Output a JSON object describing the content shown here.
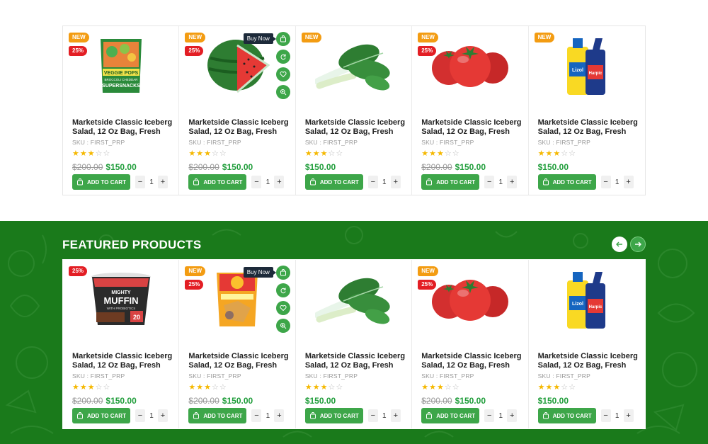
{
  "colors": {
    "green": "#3da649",
    "section_bg": "#1a7a1b",
    "badge_new": "#f39c12",
    "badge_off": "#e31e24"
  },
  "tooltip": "Buy Now",
  "featured": {
    "title": "FEATURED PRODUCTS"
  },
  "row1": [
    {
      "new": "NEW",
      "off": "25%",
      "title": "Marketside Classic Iceberg Salad, 12 Oz Bag, Fresh",
      "sku": "SKU : FIRST_PRP",
      "old": "$200.00",
      "price": "$150.00",
      "cart": "ADD TO CART",
      "qty": "1",
      "rating": 3,
      "image": "veggie-pops-bag-icon"
    },
    {
      "new": "NEW",
      "off": "25%",
      "title": "Marketside Classic Iceberg Salad, 12 Oz Bag, Fresh",
      "sku": "SKU : FIRST_PRP",
      "old": "$200.00",
      "price": "$150.00",
      "cart": "ADD TO CART",
      "qty": "1",
      "rating": 3,
      "image": "watermelon-icon"
    },
    {
      "new": "NEW",
      "title": "Marketside Classic Iceberg Salad, 12 Oz Bag, Fresh",
      "sku": "SKU : FIRST_PRP",
      "price": "$150.00",
      "cart": "ADD TO CART",
      "qty": "1",
      "rating": 3,
      "image": "bok-choy-icon"
    },
    {
      "new": "NEW",
      "off": "25%",
      "title": "Marketside Classic Iceberg Salad, 12 Oz Bag, Fresh",
      "sku": "SKU : FIRST_PRP",
      "old": "$200.00",
      "price": "$150.00",
      "cart": "ADD TO CART",
      "qty": "1",
      "rating": 3,
      "image": "tomatoes-icon"
    },
    {
      "new": "NEW",
      "title": "Marketside Classic Iceberg Salad, 12 Oz Bag, Fresh",
      "sku": "SKU : FIRST_PRP",
      "price": "$150.00",
      "cart": "ADD TO CART",
      "qty": "1",
      "rating": 3,
      "image": "cleaner-bottles-icon"
    }
  ],
  "row2": [
    {
      "off": "25%",
      "title": "Marketside Classic Iceberg Salad, 12 Oz Bag, Fresh",
      "sku": "SKU : FIRST_PRP",
      "old": "$200.00",
      "price": "$150.00",
      "cart": "ADD TO CART",
      "qty": "1",
      "rating": 3,
      "image": "muffin-cup-icon"
    },
    {
      "new": "NEW",
      "off": "25%",
      "title": "Marketside Classic Iceberg Salad, 12 Oz Bag, Fresh",
      "sku": "SKU : FIRST_PRP",
      "old": "$200.00",
      "price": "$150.00",
      "cart": "ADD TO CART",
      "qty": "1",
      "rating": 3,
      "image": "chips-packet-icon"
    },
    {
      "title": "Marketside Classic Iceberg Salad, 12 Oz Bag, Fresh",
      "sku": "SKU : FIRST_PRP",
      "price": "$150.00",
      "cart": "ADD TO CART",
      "qty": "1",
      "rating": 3,
      "image": "bok-choy-icon"
    },
    {
      "new": "NEW",
      "off": "25%",
      "title": "Marketside Classic Iceberg Salad, 12 Oz Bag, Fresh",
      "sku": "SKU : FIRST_PRP",
      "old": "$200.00",
      "price": "$150.00",
      "cart": "ADD TO CART",
      "qty": "1",
      "rating": 3,
      "image": "tomatoes-icon"
    },
    {
      "title": "Marketside Classic Iceberg Salad, 12 Oz Bag, Fresh",
      "sku": "SKU : FIRST_PRP",
      "price": "$150.00",
      "cart": "ADD TO CART",
      "qty": "1",
      "rating": 3,
      "image": "cleaner-bottles-icon"
    }
  ],
  "product_labels": {
    "veggie_pops": {
      "line1": "VEGGIE POPS",
      "line2": "BROCCOLI CHEDDAR",
      "line3": "SUPERSNACKS"
    },
    "muffin": {
      "line1": "MIGHTY",
      "line2": "MUFFIN",
      "line3": "WITH PROBIOTICS",
      "cal": "20"
    },
    "cleaner": {
      "brand": "Lizol",
      "brand2": "Harpic"
    }
  }
}
